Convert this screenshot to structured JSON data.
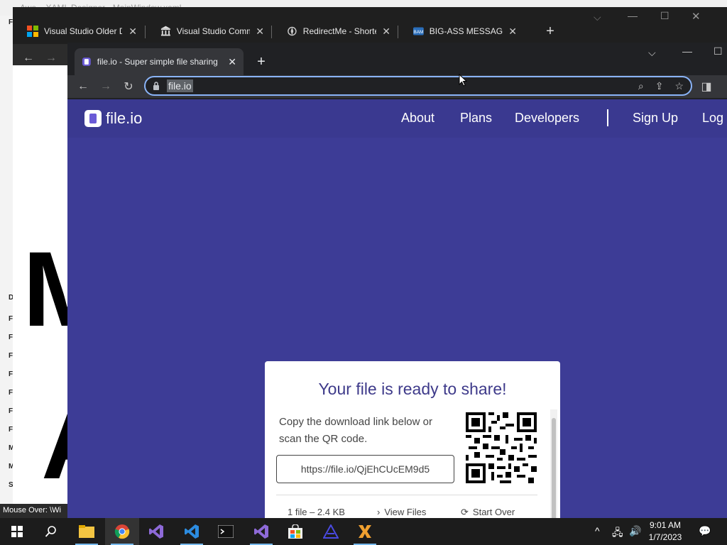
{
  "bg_app": {
    "title": "Awe... XAML Designer - MainWindow.xaml",
    "status": "Mouse Over: \\Wi",
    "left_labels": [
      "Fil",
      "D",
      "F",
      "F",
      "F",
      "F",
      "F",
      "F",
      "F",
      "M",
      "M",
      "S"
    ],
    "big_letters": [
      "M",
      "A"
    ]
  },
  "back_window": {
    "tabs": [
      {
        "title": "Visual Studio Older D",
        "icon": "microsoft-logo-icon"
      },
      {
        "title": "Visual Studio Commu",
        "icon": "bank-building-icon"
      },
      {
        "title": "RedirectMe - Shorten",
        "icon": "compass-icon"
      },
      {
        "title": "BIG-ASS MESSAGE",
        "icon": "bam-logo-icon"
      }
    ],
    "new_tab": "+"
  },
  "front_window": {
    "tab_title": "file.io - Super simple file sharing",
    "new_tab": "+",
    "url": "file.io"
  },
  "site": {
    "logo_text": "file.io",
    "nav": [
      "About",
      "Plans",
      "Developers",
      "Sign Up",
      "Log"
    ],
    "card": {
      "title": "Your file is ready to share!",
      "instructions": "Copy the download link below or scan the QR code.",
      "link": "https://file.io/QjEhCUcEM9d5",
      "file_info": "1 file – 2.4 KB",
      "view_files": "View Files",
      "start_over": "Start Over"
    }
  },
  "taskbar": {
    "time": "9:01 AM",
    "date": "1/7/2023"
  },
  "colors": {
    "page_bg": "#3d3c96",
    "accent_title": "#3e3a8a",
    "focus_ring": "#8ab4f8"
  }
}
